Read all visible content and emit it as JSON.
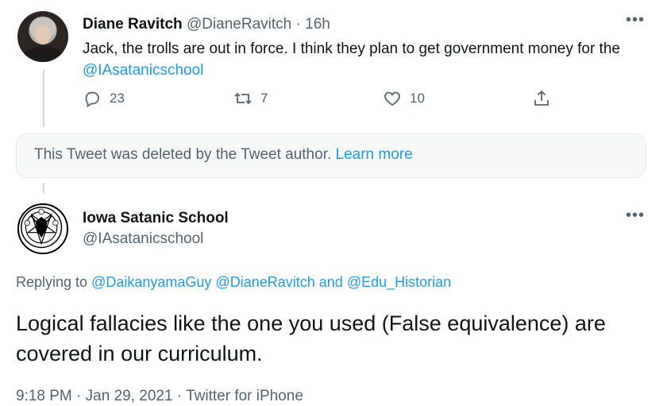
{
  "tweet1": {
    "author_name": "Diane Ravitch",
    "author_handle": "@DianeRavitch",
    "dot": "·",
    "time": "16h",
    "more": "•••",
    "text_before_mention": "Jack, the trolls are out in force. I think they plan to get government money for the ",
    "mention": "@IAsatanicschool",
    "replies": "23",
    "retweets": "7",
    "likes": "10"
  },
  "deleted_notice": {
    "text": "This Tweet was deleted by the Tweet author.",
    "link": "Learn more"
  },
  "tweet2": {
    "author_name": "Iowa Satanic School",
    "author_handle": "@IAsatanicschool",
    "more": "•••",
    "replying_prefix": "Replying to",
    "replying_mention1": "@DaikanyamaGuy",
    "replying_mention2": "@DianeRavitch",
    "replying_and": "and",
    "replying_mention3": "@Edu_Historian",
    "text": "Logical fallacies like the one you used (False equivalence) are covered in our curriculum.",
    "time": "9:18 PM",
    "dot1": "·",
    "date": "Jan 29, 2021",
    "dot2": "·",
    "source": "Twitter for iPhone"
  },
  "colors": {
    "link": "#1d9bf0",
    "muted": "#536471",
    "text": "#0f1419"
  },
  "icons": [
    "reply-icon",
    "retweet-icon",
    "like-icon",
    "share-icon",
    "more-icon",
    "pentagram-icon"
  ]
}
